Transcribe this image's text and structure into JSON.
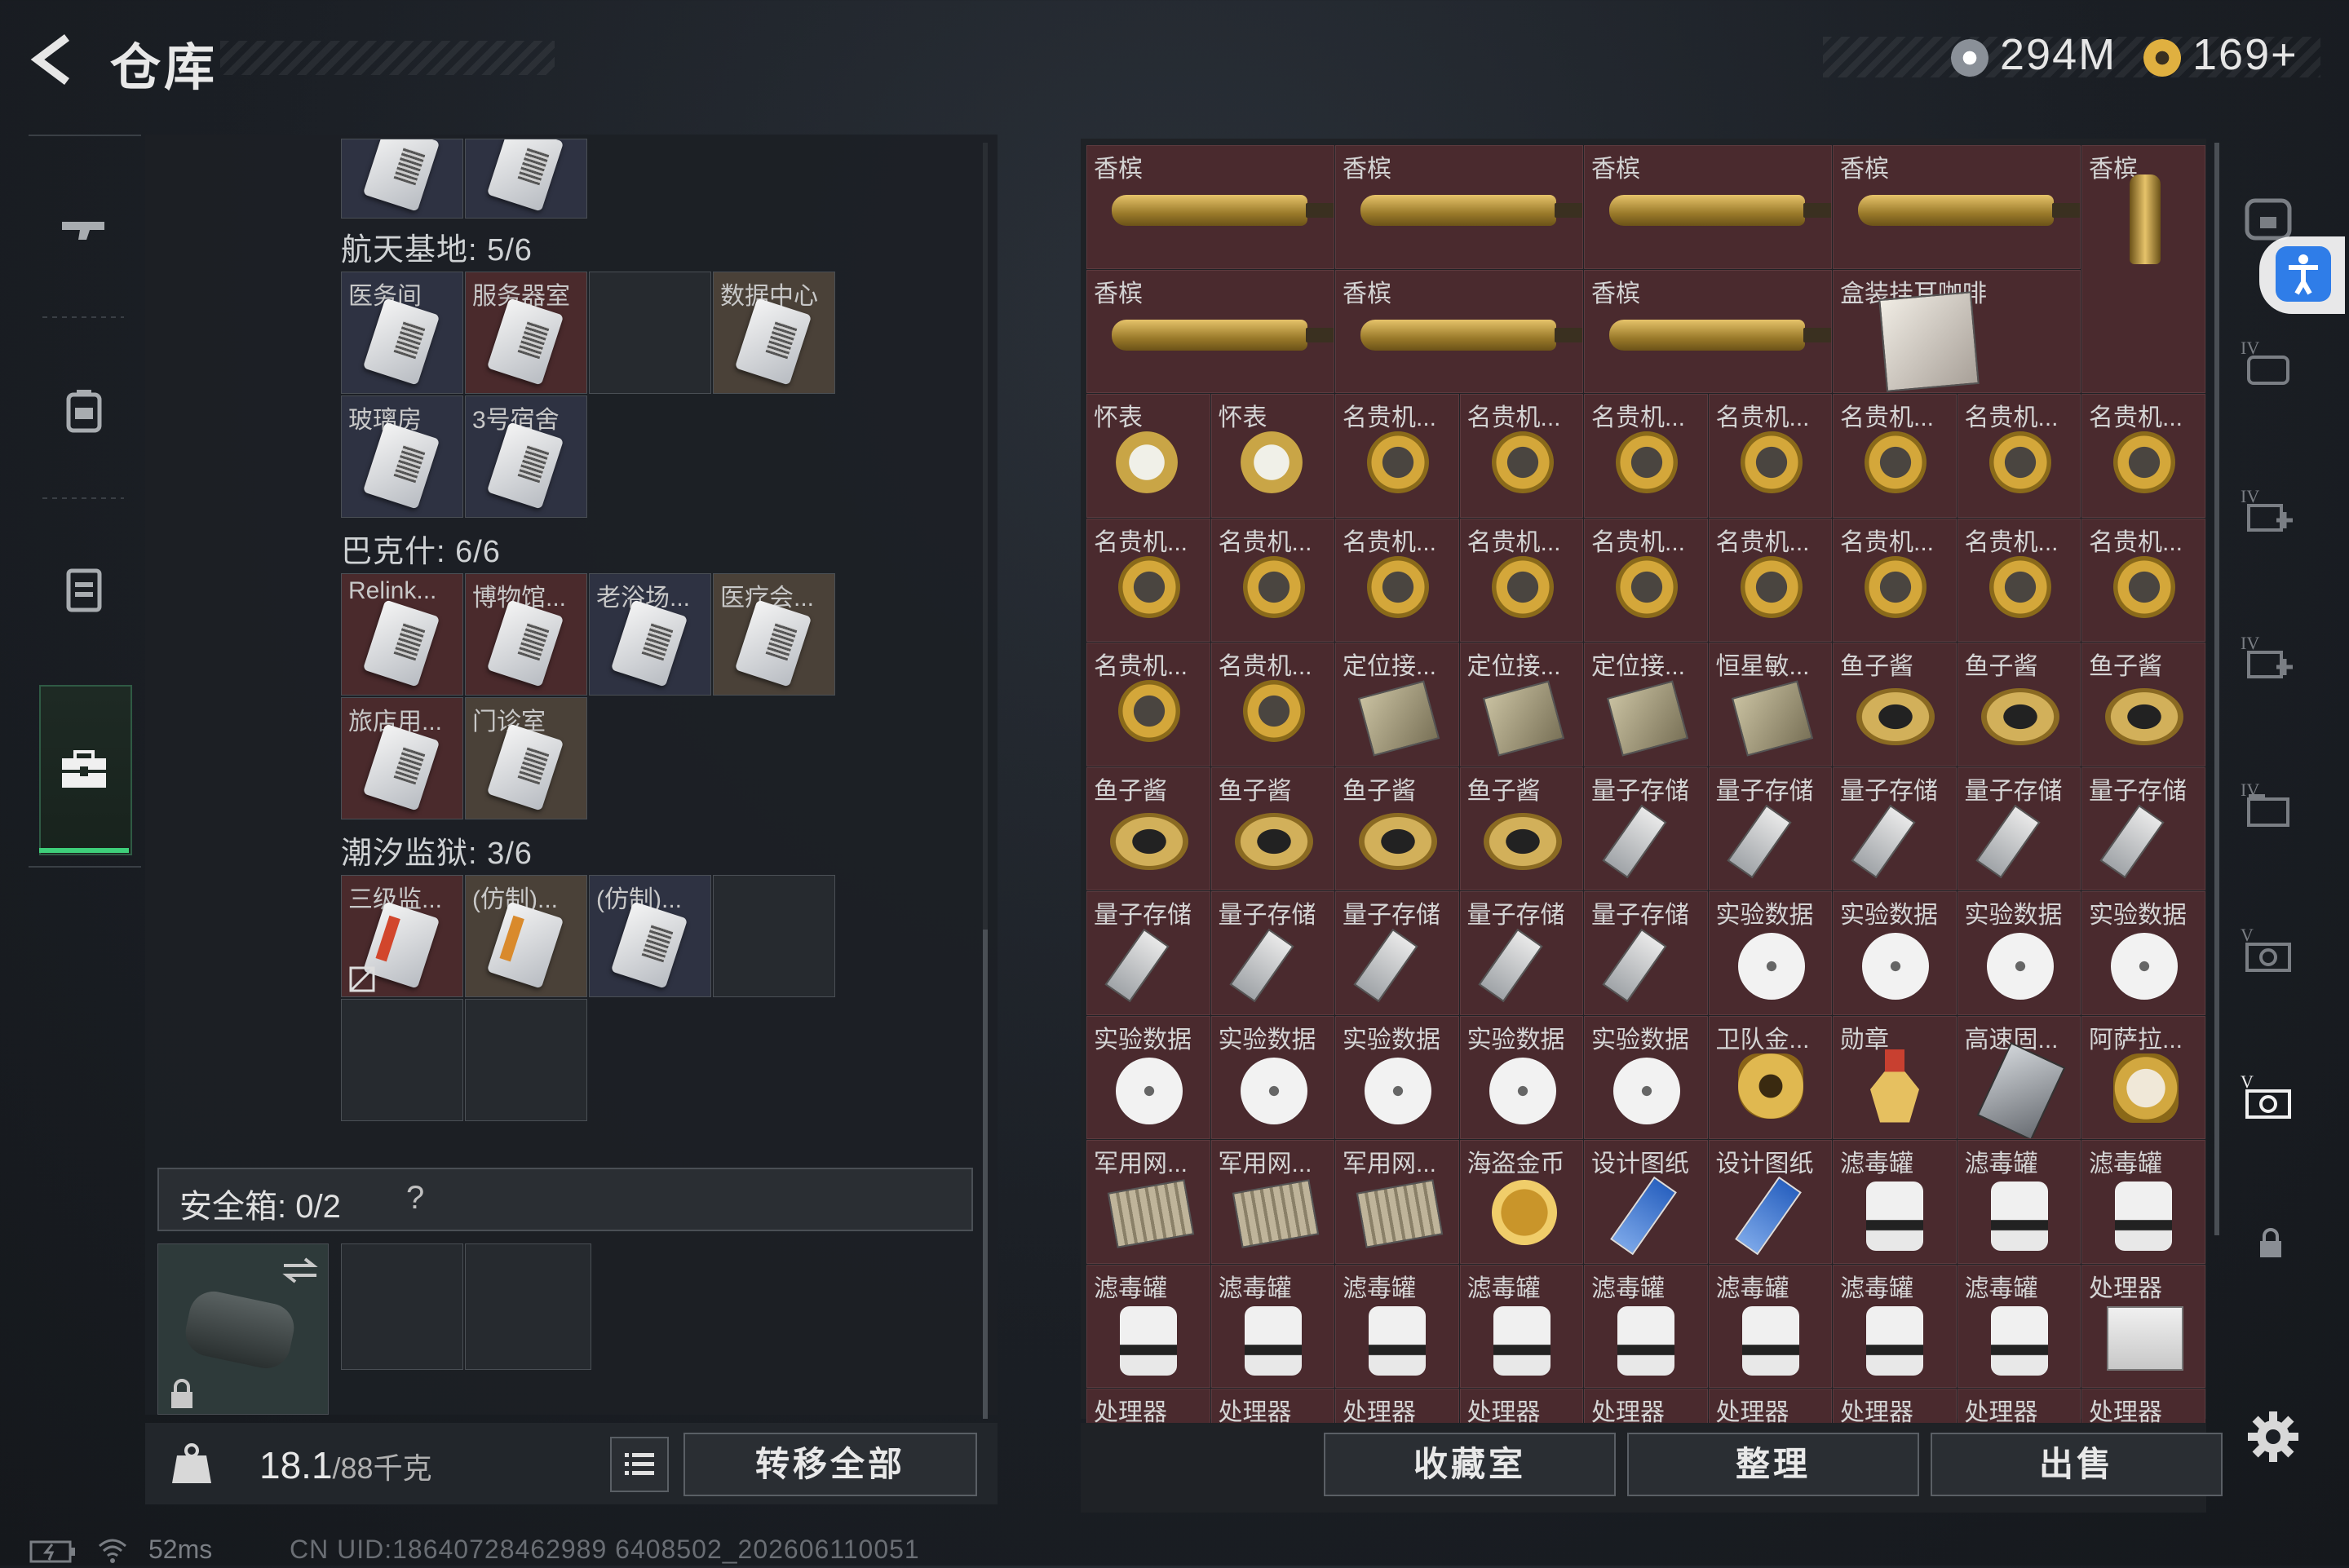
{
  "header": {
    "title": "仓库",
    "currency_a": "294M",
    "currency_b": "169+"
  },
  "colors": {
    "accent_green": "#3ecf7a",
    "slot_red": "#4a2a2e",
    "slot_blue": "#2e3242",
    "accessibility_blue": "#2f7de8"
  },
  "left_nav": {
    "items": [
      {
        "icon": "gun-icon"
      },
      {
        "icon": "backpack-icon"
      },
      {
        "icon": "vest-icon"
      },
      {
        "icon": "toolbox-icon",
        "active": true
      }
    ]
  },
  "keycards": {
    "sections": [
      {
        "label": "航天基地: 5/6",
        "cards": [
          "医务间",
          "服务器室",
          "数据中心",
          "玻璃房",
          "3号宿舍"
        ]
      },
      {
        "label": "巴克什: 6/6",
        "cards": [
          "Relink...",
          "博物馆...",
          "老浴场...",
          "医疗会...",
          "旅店用...",
          "门诊室"
        ]
      },
      {
        "label": "潮汐监狱: 3/6",
        "cards": [
          "三级监...",
          "(仿制)...",
          "(仿制)..."
        ]
      }
    ]
  },
  "safebox": {
    "label": "安全箱: 0/2",
    "help": "?"
  },
  "bottom_left": {
    "weight": "18.1",
    "weight_max": "/88千克",
    "transfer_all": "转移全部"
  },
  "items": {
    "rows": [
      [
        "香槟",
        "香槟",
        "香槟",
        "香槟",
        "香槟"
      ],
      [
        "香槟",
        "香槟",
        "香槟",
        "盒装挂耳咖啡"
      ],
      [
        "怀表",
        "怀表",
        "名贵机...",
        "名贵机...",
        "名贵机...",
        "名贵机...",
        "名贵机...",
        "名贵机...",
        "名贵机..."
      ],
      [
        "名贵机...",
        "名贵机...",
        "名贵机...",
        "名贵机...",
        "名贵机...",
        "名贵机...",
        "名贵机...",
        "名贵机...",
        "名贵机..."
      ],
      [
        "名贵机...",
        "名贵机...",
        "定位接...",
        "定位接...",
        "定位接...",
        "恒星敏...",
        "鱼子酱",
        "鱼子酱",
        "鱼子酱"
      ],
      [
        "鱼子酱",
        "鱼子酱",
        "鱼子酱",
        "鱼子酱",
        "量子存储",
        "量子存储",
        "量子存储",
        "量子存储",
        "量子存储"
      ],
      [
        "量子存储",
        "量子存储",
        "量子存储",
        "量子存储",
        "量子存储",
        "实验数据",
        "实验数据",
        "实验数据",
        "实验数据"
      ],
      [
        "实验数据",
        "实验数据",
        "实验数据",
        "实验数据",
        "实验数据",
        "卫队金...",
        "勋章",
        "高速固...",
        "阿萨拉..."
      ],
      [
        "军用网...",
        "军用网...",
        "军用网...",
        "海盗金币",
        "设计图纸",
        "设计图纸",
        "滤毒罐",
        "滤毒罐",
        "滤毒罐"
      ],
      [
        "滤毒罐",
        "滤毒罐",
        "滤毒罐",
        "滤毒罐",
        "滤毒罐",
        "滤毒罐",
        "滤毒罐",
        "滤毒罐",
        "处理器"
      ],
      [
        "处理器",
        "处理器",
        "处理器",
        "处理器",
        "处理器",
        "处理器",
        "处理器",
        "处理器",
        "处理器"
      ]
    ]
  },
  "bottom_right": {
    "collection": "收藏室",
    "sort": "整理",
    "sell": "出售"
  },
  "status": {
    "ping": "52ms",
    "uid": "CN UID:18640728462989 6408502_202606110051"
  }
}
